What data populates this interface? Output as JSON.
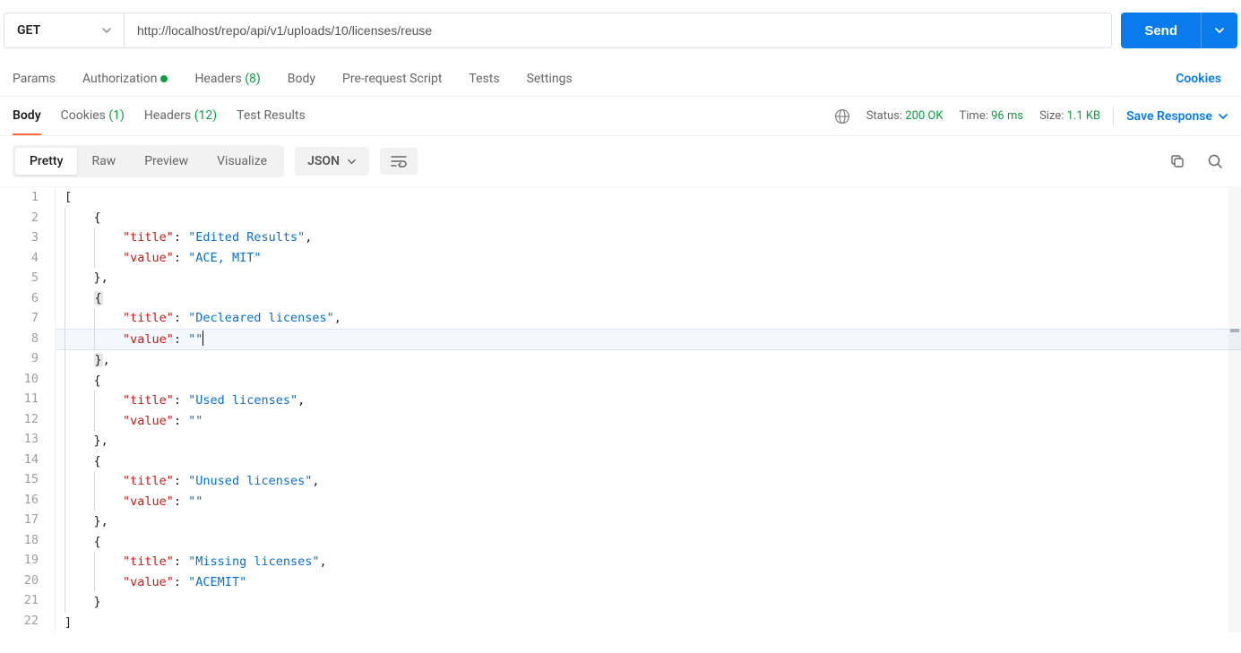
{
  "request": {
    "method": "GET",
    "url": "http://localhost/repo/api/v1/uploads/10/licenses/reuse",
    "send_label": "Send"
  },
  "request_tabs": {
    "params": "Params",
    "authorization": "Authorization",
    "headers": "Headers",
    "headers_count": "(8)",
    "body": "Body",
    "prerequest": "Pre-request Script",
    "tests": "Tests",
    "settings": "Settings",
    "cookies_link": "Cookies"
  },
  "response_tabs": {
    "body": "Body",
    "cookies": "Cookies",
    "cookies_count": "(1)",
    "headers": "Headers",
    "headers_count": "(12)",
    "test_results": "Test Results"
  },
  "response_meta": {
    "status_label": "Status:",
    "status_value": "200 OK",
    "time_label": "Time:",
    "time_value": "96 ms",
    "size_label": "Size:",
    "size_value": "1.1 KB",
    "save_response": "Save Response"
  },
  "view": {
    "pretty": "Pretty",
    "raw": "Raw",
    "preview": "Preview",
    "visualize": "Visualize",
    "format": "JSON"
  },
  "code": {
    "cursor_line": 8,
    "highlighted_brace_line_open": 6,
    "highlighted_brace_line_close": 9,
    "body": [
      {
        "title": "Edited Results",
        "value": "ACE, MIT"
      },
      {
        "title": "Decleared licenses",
        "value": ""
      },
      {
        "title": "Used licenses",
        "value": ""
      },
      {
        "title": "Unused licenses",
        "value": ""
      },
      {
        "title": "Missing licenses",
        "value": "ACEMIT"
      }
    ]
  }
}
